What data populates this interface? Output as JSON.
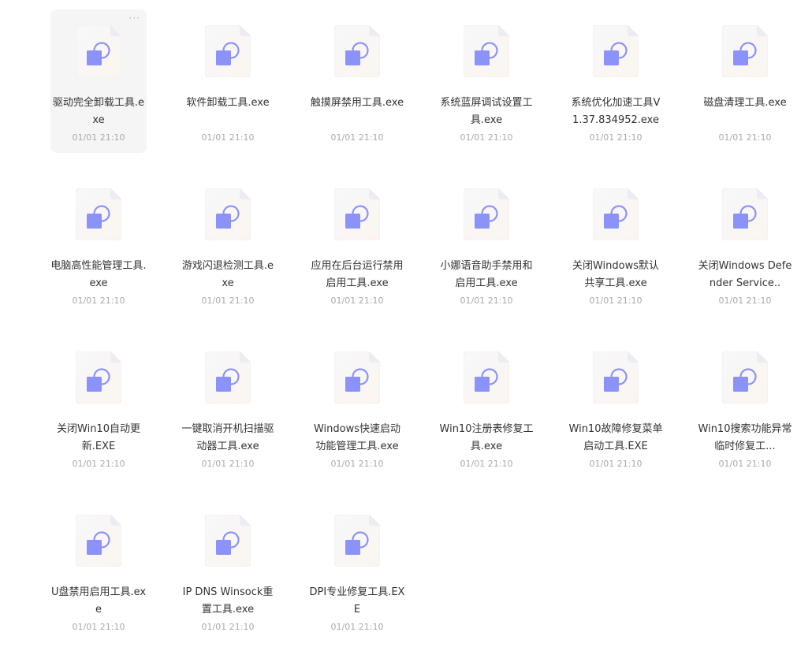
{
  "files": [
    {
      "name": "驱动完全卸载工具.exe",
      "date": "01/01 21:10",
      "icon": "exe-file-icon",
      "selected": true
    },
    {
      "name": "软件卸载工具.exe",
      "date": "01/01 21:10",
      "icon": "exe-file-icon"
    },
    {
      "name": "触摸屏禁用工具.exe",
      "date": "01/01 21:10",
      "icon": "exe-file-icon"
    },
    {
      "name": "系统蓝屏调试设置工具.exe",
      "date": "01/01 21:10",
      "icon": "exe-file-icon"
    },
    {
      "name": "系统优化加速工具V1.37.834952.exe",
      "date": "01/01 21:10",
      "icon": "exe-file-icon"
    },
    {
      "name": "磁盘清理工具.exe",
      "date": "01/01 21:10",
      "icon": "exe-file-icon"
    },
    {
      "name": "电脑高性能管理工具.exe",
      "date": "01/01 21:10",
      "icon": "exe-file-icon"
    },
    {
      "name": "游戏闪退检测工具.exe",
      "date": "01/01 21:10",
      "icon": "exe-file-icon"
    },
    {
      "name": "应用在后台运行禁用启用工具.exe",
      "date": "01/01 21:10",
      "icon": "exe-file-icon"
    },
    {
      "name": "小娜语音助手禁用和启用工具.exe",
      "date": "01/01 21:10",
      "icon": "exe-file-icon"
    },
    {
      "name": "关闭Windows默认共享工具.exe",
      "date": "01/01 21:10",
      "icon": "exe-file-icon"
    },
    {
      "name": "关闭Windows Defender Service..",
      "date": "01/01 21:10",
      "icon": "exe-file-icon"
    },
    {
      "name": "关闭Win10自动更新.EXE",
      "date": "01/01 21:10",
      "icon": "exe-file-icon"
    },
    {
      "name": "一键取消开机扫描驱动器工具.exe",
      "date": "01/01 21:10",
      "icon": "exe-file-icon"
    },
    {
      "name": "Windows快速启动功能管理工具.exe",
      "date": "01/01 21:10",
      "icon": "exe-file-icon"
    },
    {
      "name": "Win10注册表修复工具.exe",
      "date": "01/01 21:10",
      "icon": "exe-file-icon"
    },
    {
      "name": "Win10故障修复菜单启动工具.EXE",
      "date": "01/01 21:10",
      "icon": "exe-file-icon"
    },
    {
      "name": "Win10搜索功能异常临时修复工...",
      "date": "01/01 21:10",
      "icon": "exe-file-icon"
    },
    {
      "name": "U盘禁用启用工具.exe",
      "date": "01/01 21:10",
      "icon": "exe-file-icon"
    },
    {
      "name": "IP DNS Winsock重置工具.exe",
      "date": "01/01 21:10",
      "icon": "exe-file-icon"
    },
    {
      "name": "DPI专业修复工具.EXE",
      "date": "01/01 21:10",
      "icon": "exe-file-icon"
    }
  ],
  "more_glyph": "···",
  "colors": {
    "icon_square": "#8b93fb",
    "icon_ring": "#8b93fb",
    "icon_page": "#f6f7fa",
    "selected_bg": "#f5f5f5"
  }
}
